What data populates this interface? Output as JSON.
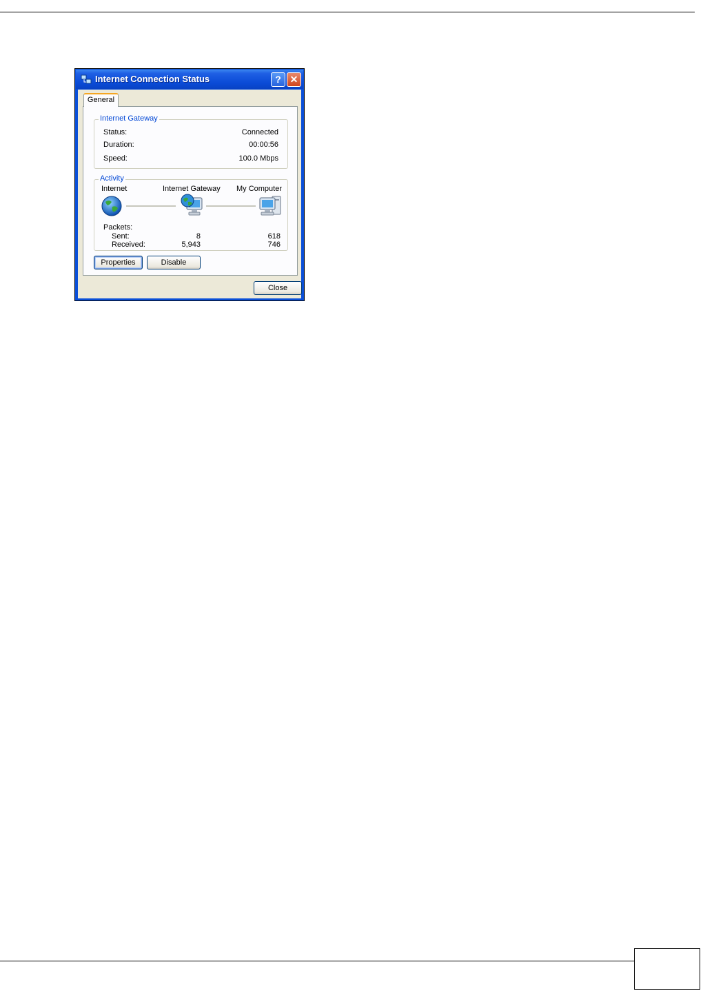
{
  "dialog": {
    "title": "Internet Connection Status",
    "help_glyph": "?",
    "close_glyph": "✕",
    "tab_label": "General",
    "gateway_group": {
      "legend": "Internet Gateway",
      "rows": [
        {
          "label": "Status:",
          "value": "Connected"
        },
        {
          "label": "Duration:",
          "value": "00:00:56"
        },
        {
          "label": "Speed:",
          "value": "100.0 Mbps"
        }
      ]
    },
    "activity_group": {
      "legend": "Activity",
      "nodes": [
        "Internet",
        "Internet Gateway",
        "My Computer"
      ],
      "packets_label": "Packets:",
      "sent_label": "Sent:",
      "received_label": "Received:",
      "sent_left": "8",
      "sent_right": "618",
      "received_left": "5,943",
      "received_right": "746"
    },
    "buttons": {
      "properties": "Properties",
      "disable": "Disable",
      "close": "Close"
    }
  },
  "colors": {
    "titlebar": "#0a4bd6",
    "legend_text": "#0046d5",
    "tab_accent": "#f5a623",
    "face": "#ece9d8"
  }
}
